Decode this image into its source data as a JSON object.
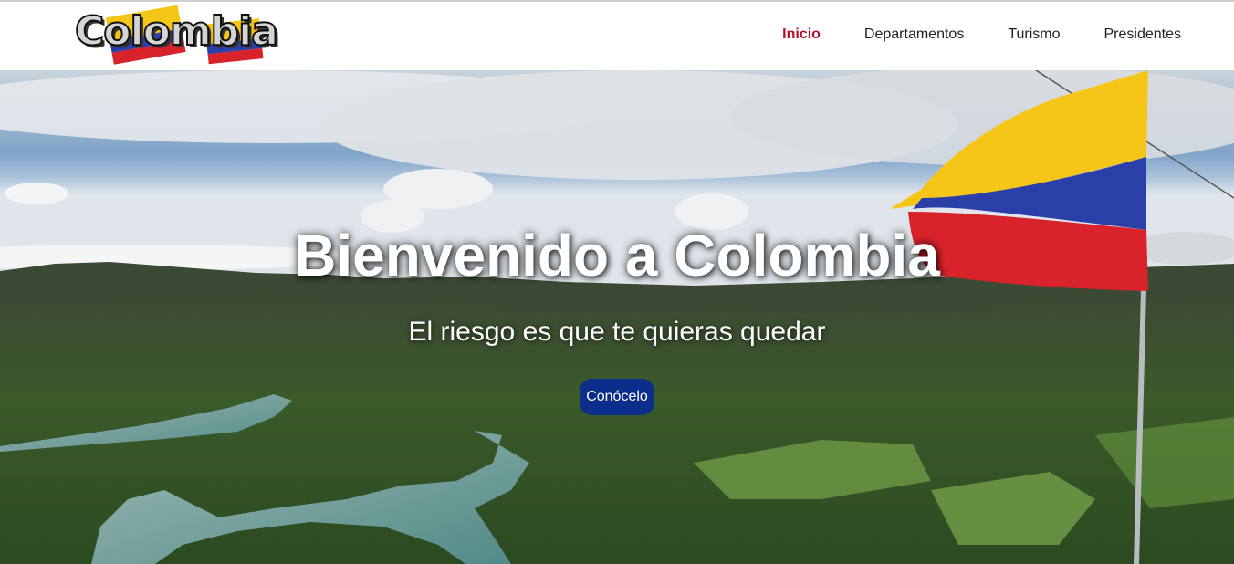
{
  "header": {
    "logo_text": "Colombia",
    "nav": [
      {
        "label": "Inicio",
        "active": true
      },
      {
        "label": "Departamentos",
        "active": false
      },
      {
        "label": "Turismo",
        "active": false
      },
      {
        "label": "Presidentes",
        "active": false
      }
    ]
  },
  "hero": {
    "title": "Bienvenido a Colombia",
    "subtitle": "El riesgo es que te quieras quedar",
    "button_label": "Conócelo"
  },
  "colors": {
    "active_nav": "#b0122b",
    "button_bg": "#0a2e8a",
    "flag_yellow": "#f5c518",
    "flag_blue": "#2b3fa8",
    "flag_red": "#d8232a"
  },
  "icons": {
    "logo_flag": "colombia-flag-icon",
    "hero_flag": "colombia-flag-icon"
  }
}
